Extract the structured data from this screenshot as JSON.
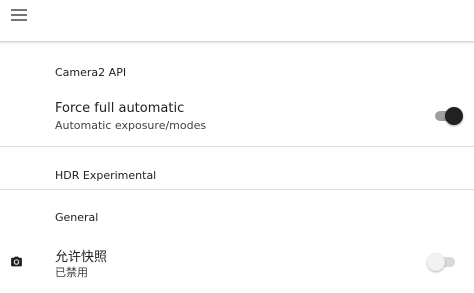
{
  "appbar": {
    "menu_icon": "hamburger-menu-icon"
  },
  "sections": {
    "camera2_api": "Camera2 API",
    "hdr_experimental": "HDR Experimental",
    "general": "General"
  },
  "settings": {
    "force_full_automatic": {
      "title": "Force full automatic",
      "summary": "Automatic exposure/modes",
      "enabled": true
    },
    "allow_snapshot": {
      "icon": "camera-icon",
      "title": "允许快照",
      "summary": "已禁用",
      "enabled": false
    }
  },
  "colors": {
    "toggle_on_thumb": "#212121",
    "toggle_off_thumb": "#f1f1f1",
    "text_primary": "#212121"
  }
}
